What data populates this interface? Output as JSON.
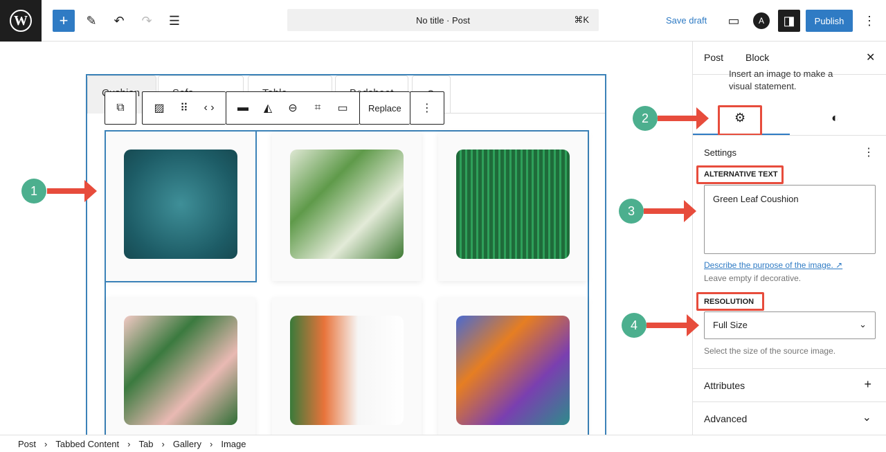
{
  "topbar": {
    "logo": "W",
    "title": "No title · Post",
    "shortcut": "⌘K",
    "save_draft": "Save draft",
    "publish": "Publish"
  },
  "tabs": [
    "Cushion",
    "Sofa Covers",
    "Table Cover",
    "Bedsheet"
  ],
  "toolbar": {
    "replace": "Replace"
  },
  "sidebar": {
    "tab_post": "Post",
    "tab_block": "Block",
    "desc1": "Insert an image to make a",
    "desc2": "visual statement.",
    "settings": "Settings",
    "alt_label": "Alternative Text",
    "alt_value": "Green Leaf Coushion",
    "alt_link": "Describe the purpose of the image. ↗",
    "alt_help": "Leave empty if decorative.",
    "res_label": "Resolution",
    "res_value": "Full Size",
    "res_help": "Select the size of the source image.",
    "attributes": "Attributes",
    "advanced": "Advanced"
  },
  "breadcrumb": [
    "Post",
    "Tabbed Content",
    "Tab",
    "Gallery",
    "Image"
  ],
  "annotations": [
    "1",
    "2",
    "3",
    "4"
  ],
  "colors": {
    "accent": "#2f7bc4",
    "annotation": "#e74c3c",
    "badge": "#4caf8e"
  }
}
